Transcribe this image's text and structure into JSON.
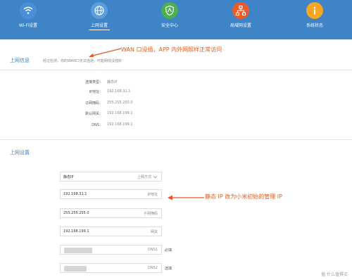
{
  "nav": {
    "items": [
      {
        "label": "Wi-Fi设置",
        "color": "#3e84c6",
        "icon": "wifi-icon"
      },
      {
        "label": "上网设置",
        "color": "#3e84c6",
        "icon": "globe-icon",
        "active": true
      },
      {
        "label": "安全中心",
        "color": "#4caf50",
        "icon": "shield-icon"
      },
      {
        "label": "局域网设置",
        "color": "#f05a28",
        "icon": "network-icon"
      },
      {
        "label": "系统状态",
        "color": "#f5a623",
        "icon": "info-icon"
      }
    ]
  },
  "info": {
    "title": "上网信息",
    "note": "经过检测，你的WAN口无法连通，可能网线没插好",
    "annotation": "WAN 口没插，APP 内外网照样正常访问",
    "rows": [
      {
        "label": "连接类型：",
        "value": "静态IP"
      },
      {
        "label": "IP地址：",
        "value": "192.168.31.1"
      },
      {
        "label": "子网掩码：",
        "value": "255.255.255.0"
      },
      {
        "label": "默认网关：",
        "value": "192.168.199.1"
      },
      {
        "label": "DNS：",
        "value": "192.168.199.1"
      }
    ]
  },
  "settings": {
    "title": "上网设置",
    "annotation": "静态 IP 改为小米初始的管理 IP",
    "fields": [
      {
        "value": "静态IP",
        "hint": "上网方式"
      },
      {
        "value": "192.168.31.1",
        "hint": "IP地址"
      },
      {
        "value": "255.255.255.0",
        "hint": "子网掩码"
      },
      {
        "value": "192.168.199.1",
        "hint": "网关"
      },
      {
        "value": "",
        "hint": "DNS1",
        "required": "必填"
      },
      {
        "value": "",
        "hint": "DNS2",
        "required": "选填"
      }
    ]
  },
  "watermark": "值 什么值得买"
}
